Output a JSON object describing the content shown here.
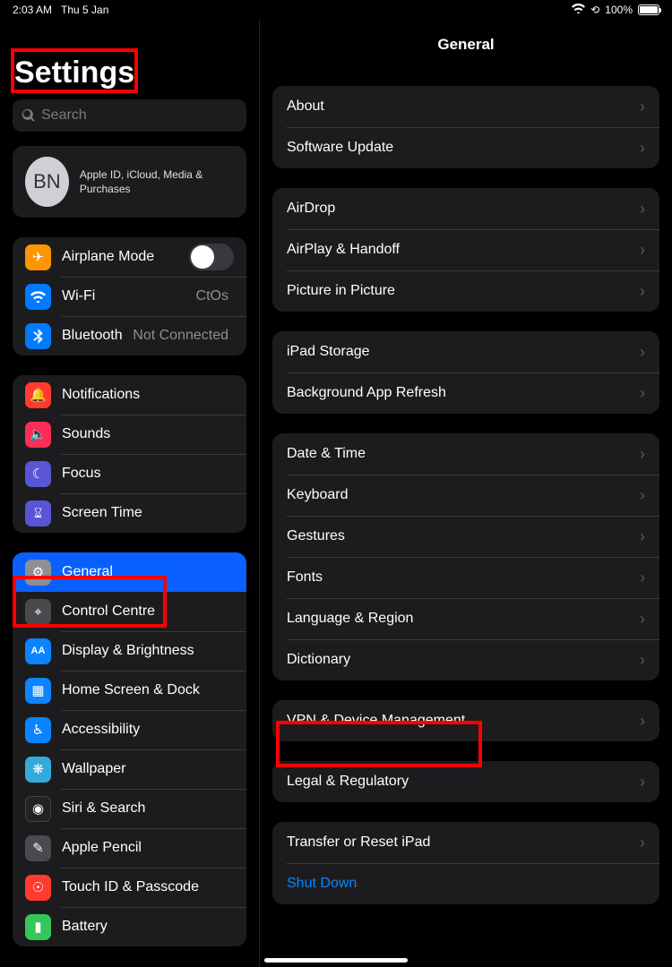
{
  "status": {
    "time": "2:03 AM",
    "date": "Thu 5 Jan",
    "battery_pct": "100%"
  },
  "sidebar": {
    "title": "Settings",
    "search_placeholder": "Search",
    "account": {
      "initials": "BN",
      "sub": "Apple ID, iCloud, Media & Purchases"
    },
    "group1": [
      {
        "label": "Airplane Mode",
        "icon": "✈︎",
        "bg": "bg-orange",
        "type": "toggle"
      },
      {
        "label": "Wi-Fi",
        "icon": "",
        "bg": "bg-blue",
        "type": "link",
        "value": "CtOs"
      },
      {
        "label": "Bluetooth",
        "icon": "",
        "bg": "bg-blue",
        "type": "link",
        "value": "Not Connected"
      }
    ],
    "group2": [
      {
        "label": "Notifications",
        "icon": "🔔",
        "bg": "bg-red"
      },
      {
        "label": "Sounds",
        "icon": "🔈",
        "bg": "bg-pink"
      },
      {
        "label": "Focus",
        "icon": "☾",
        "bg": "bg-purple"
      },
      {
        "label": "Screen Time",
        "icon": "⌛︎",
        "bg": "bg-purple"
      }
    ],
    "group3": [
      {
        "label": "General",
        "icon": "⚙︎",
        "bg": "bg-gray",
        "selected": true
      },
      {
        "label": "Control Centre",
        "icon": "⌖",
        "bg": "bg-darkgray"
      },
      {
        "label": "Display & Brightness",
        "icon": "AA",
        "bg": "bg-bluel"
      },
      {
        "label": "Home Screen & Dock",
        "icon": "▦",
        "bg": "bg-bluel"
      },
      {
        "label": "Accessibility",
        "icon": "♿︎",
        "bg": "bg-bluel"
      },
      {
        "label": "Wallpaper",
        "icon": "❋",
        "bg": "bg-cyan"
      },
      {
        "label": "Siri & Search",
        "icon": "◉",
        "bg": "bg-black"
      },
      {
        "label": "Apple Pencil",
        "icon": "✎",
        "bg": "bg-darkgray"
      },
      {
        "label": "Touch ID & Passcode",
        "icon": "☉",
        "bg": "bg-red"
      },
      {
        "label": "Battery",
        "icon": "▮",
        "bg": "bg-green"
      }
    ]
  },
  "main": {
    "title": "General",
    "sections": [
      [
        {
          "label": "About"
        },
        {
          "label": "Software Update"
        }
      ],
      [
        {
          "label": "AirDrop"
        },
        {
          "label": "AirPlay & Handoff"
        },
        {
          "label": "Picture in Picture"
        }
      ],
      [
        {
          "label": "iPad Storage"
        },
        {
          "label": "Background App Refresh"
        }
      ],
      [
        {
          "label": "Date & Time"
        },
        {
          "label": "Keyboard"
        },
        {
          "label": "Gestures"
        },
        {
          "label": "Fonts"
        },
        {
          "label": "Language & Region"
        },
        {
          "label": "Dictionary"
        }
      ],
      [
        {
          "label": "VPN & Device Management"
        }
      ],
      [
        {
          "label": "Legal & Regulatory"
        }
      ],
      [
        {
          "label": "Transfer or Reset iPad"
        },
        {
          "label": "Shut Down",
          "link": true
        }
      ]
    ]
  }
}
